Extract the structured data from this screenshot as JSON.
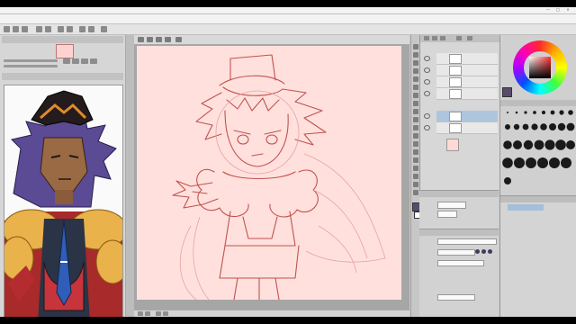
{
  "window": {
    "title": "",
    "controls": [
      "—",
      "□",
      "×"
    ]
  },
  "menubar": {
    "items": [
      "",
      "",
      "",
      "",
      "",
      "",
      "",
      "",
      "",
      "",
      ""
    ]
  },
  "left_panel": {
    "navigator_label": "",
    "reference_label": ""
  },
  "layers": [
    {
      "name": "",
      "opacity": "",
      "selected": false
    },
    {
      "name": "",
      "opacity": "",
      "selected": false
    },
    {
      "name": "",
      "opacity": "",
      "selected": false
    },
    {
      "name": "",
      "opacity": "",
      "selected": false
    },
    {
      "name": "",
      "opacity": "",
      "selected": true
    },
    {
      "name": "",
      "opacity": "",
      "selected": false
    }
  ],
  "navigator": {
    "label": ""
  },
  "tool_property": {
    "label": "",
    "rows": [
      "",
      "",
      "",
      ""
    ]
  },
  "sub_tool": {
    "rows": [
      "",
      "",
      "",
      "",
      "",
      "",
      ""
    ]
  },
  "colors": {
    "canvas_bg": "#ffe0dd",
    "sketch_line": "#c0524e",
    "accent_selection": "#adc6de",
    "current_color": "#5a4a6e"
  }
}
